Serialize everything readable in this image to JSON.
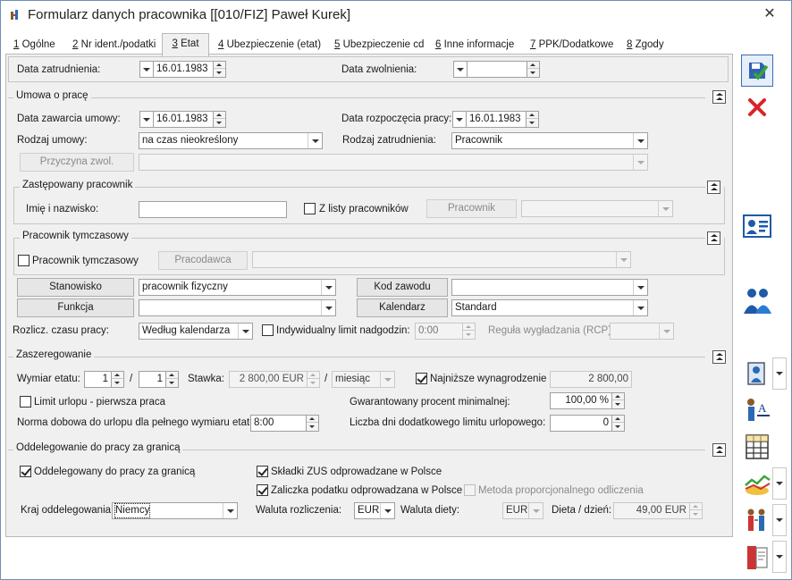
{
  "window": {
    "title": "Formularz danych pracownika [[010/FIZ] Paweł Kurek]",
    "close_glyph": "✕"
  },
  "tabs": [
    {
      "key": "1",
      "label": " Ogólne"
    },
    {
      "key": "2",
      "label": " Nr ident./podatki"
    },
    {
      "key": "3",
      "label": " Etat"
    },
    {
      "key": "4",
      "label": " Ubezpieczenie (etat)"
    },
    {
      "key": "5",
      "label": " Ubezpieczenie cd"
    },
    {
      "key": "6",
      "label": " Inne informacje"
    },
    {
      "key": "7",
      "label": " PPK/Dodatkowe"
    },
    {
      "key": "8",
      "label": " Zgody"
    }
  ],
  "top": {
    "employment_date_label": "Data zatrudnienia:",
    "employment_date": "16.01.1983",
    "dismissal_date_label": "Data zwolnienia:",
    "dismissal_date": ""
  },
  "contract": {
    "legend": "Umowa o pracę",
    "conclusion_date_label": "Data zawarcia umowy:",
    "conclusion_date": "16.01.1983",
    "start_date_label": "Data rozpoczęcia pracy:",
    "start_date": "16.01.1983",
    "contract_type_label": "Rodzaj umowy:",
    "contract_type": "na czas nieokreślony",
    "employment_type_label": "Rodzaj zatrudnienia:",
    "employment_type": "Pracownik",
    "reason_button": "Przyczyna zwol.",
    "reason_value": "",
    "replaced": {
      "legend": "Zastępowany pracownik",
      "name_label": "Imię i nazwisko:",
      "name_value": "",
      "from_list_label": "Z listy pracowników",
      "employee_button": "Pracownik",
      "employee_value": ""
    },
    "temporary": {
      "legend": "Pracownik tymczasowy",
      "check_label": "Pracownik tymczasowy",
      "employer_button": "Pracodawca",
      "employer_value": ""
    },
    "position_button": "Stanowisko",
    "position_value": "pracownik fizyczny",
    "occupation_code_button": "Kod zawodu",
    "occupation_code_value": "",
    "function_button": "Funkcja",
    "function_value": "",
    "calendar_button": "Kalendarz",
    "calendar_value": "Standard",
    "work_time_label": "Rozlicz. czasu pracy:",
    "work_time_value": "Według kalendarza",
    "overtime_limit_label": "Indywidualny limit nadgodzin:",
    "overtime_limit_value": "0:00",
    "smoothing_label": "Reguła wygładzania (RCP):",
    "smoothing_value": ""
  },
  "pay": {
    "legend": "Zaszeregowanie",
    "fte_label": "Wymiar etatu:",
    "fte_num": "1",
    "fte_sep": "/",
    "fte_den": "1",
    "rate_label": "Stawka:",
    "rate_value": "2 800,00 EUR",
    "rate_sep": "/",
    "rate_period": "miesiąc",
    "lowest_pay_label": "Najniższe wynagrodzenie",
    "lowest_pay_value": "2 800,00",
    "leave_limit_label": "Limit urlopu - pierwsza praca",
    "guaranteed_label": "Gwarantowany procent minimalnej:",
    "guaranteed_value": "100,00 %",
    "daily_norm_label": "Norma dobowa do urlopu dla pełnego wymiaru etatu:",
    "daily_norm_value": "8:00",
    "extra_days_label": "Liczba dni dodatkowego limitu urlopowego:",
    "extra_days_value": "0"
  },
  "abroad": {
    "legend": "Oddelegowanie do pracy za granicą",
    "delegated_label": "Oddelegowany do pracy za granicą",
    "zus_label": "Składki ZUS odprowadzane w Polsce",
    "tax_label": "Zaliczka podatku odprowadzana w Polsce",
    "proportional_label": "Metoda proporcjonalnego odliczenia",
    "country_label": "Kraj oddelegowania:",
    "country_value": "Niemcy",
    "settlement_currency_label": "Waluta rozliczenia:",
    "settlement_currency": "EUR",
    "diet_currency_label": "Waluta diety:",
    "diet_currency": "EUR",
    "diet_per_day_label": "Dieta / dzień:",
    "diet_per_day_value": "49,00 EUR"
  }
}
